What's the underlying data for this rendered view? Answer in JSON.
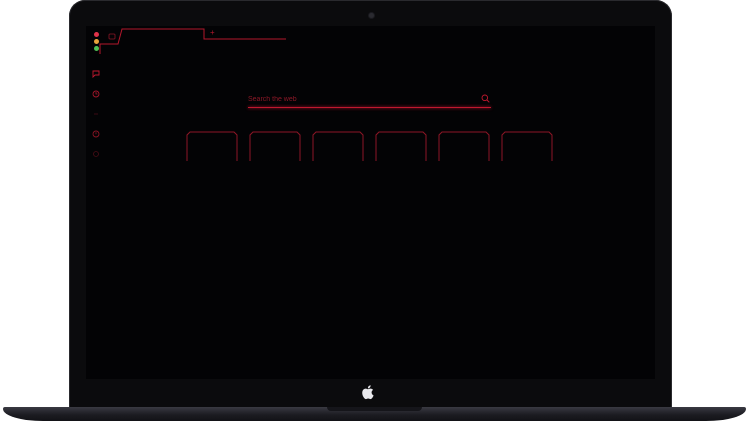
{
  "browser": {
    "tabs": [
      {
        "icon": "speed-dial-icon",
        "active": true
      }
    ],
    "new_tab_label": "+",
    "window_controls": {
      "close_color": "#e0334a",
      "minimize_color": "#e8a33c",
      "maximize_color": "#4fbf55"
    },
    "sidebar": {
      "items": [
        {
          "icon": "messenger-icon"
        },
        {
          "icon": "history-icon"
        },
        {
          "icon": "separator-dash-icon"
        },
        {
          "icon": "clock-icon"
        },
        {
          "icon": "dot-icon"
        }
      ]
    },
    "search": {
      "placeholder": "Search the web"
    },
    "speed_dial": {
      "tiles": [
        {},
        {},
        {},
        {},
        {},
        {}
      ]
    },
    "accent_color": "#c0182e"
  },
  "device": {
    "logo": "apple-logo"
  }
}
